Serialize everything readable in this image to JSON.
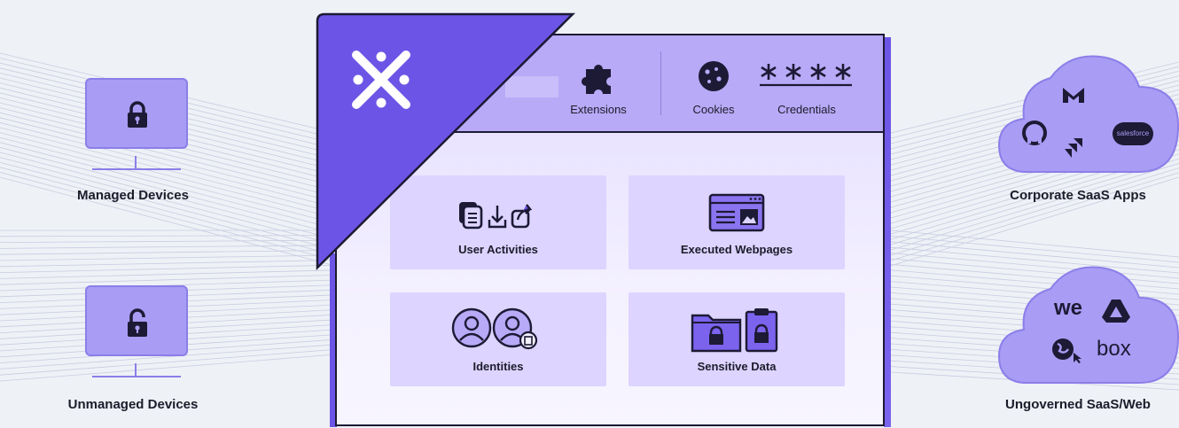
{
  "devices": {
    "managed": {
      "label": "Managed Devices",
      "lock": "locked-padlock-icon"
    },
    "unmanaged": {
      "label": "Unmanaged Devices",
      "lock": "unlocked-padlock-icon"
    }
  },
  "panel": {
    "logo": "x-logo-icon",
    "top_items": [
      {
        "label": "Extensions",
        "icon": "puzzle-icon"
      },
      {
        "label": "Cookies",
        "icon": "cookie-icon"
      },
      {
        "label": "Credentials",
        "icon": "asterisks-icon"
      }
    ],
    "tiles": [
      {
        "label": "User Activities",
        "icon": "activities-icon"
      },
      {
        "label": "Executed Webpages",
        "icon": "webpage-icon"
      },
      {
        "label": "Identities",
        "icon": "identities-icon"
      },
      {
        "label": "Sensitive Data",
        "icon": "sensitive-data-icon"
      }
    ]
  },
  "clouds": {
    "corporate": {
      "label": "Corporate SaaS Apps",
      "apps": [
        "gmail-icon",
        "github-icon",
        "jira-icon",
        "salesforce-icon"
      ],
      "salesforce_text": "salesforce"
    },
    "ungoverned": {
      "label": "Ungoverned SaaS/Web",
      "apps": [
        "wetransfer-icon",
        "google-drive-icon",
        "web-globe-icon",
        "box-icon"
      ],
      "wetransfer_text": "we",
      "box_text": "box"
    }
  },
  "colors": {
    "accent": "#6c55e6",
    "light_purple": "#b8aaf7",
    "tile": "#ddd4ff",
    "dark": "#1c1a35",
    "background": "#eef1f6"
  }
}
